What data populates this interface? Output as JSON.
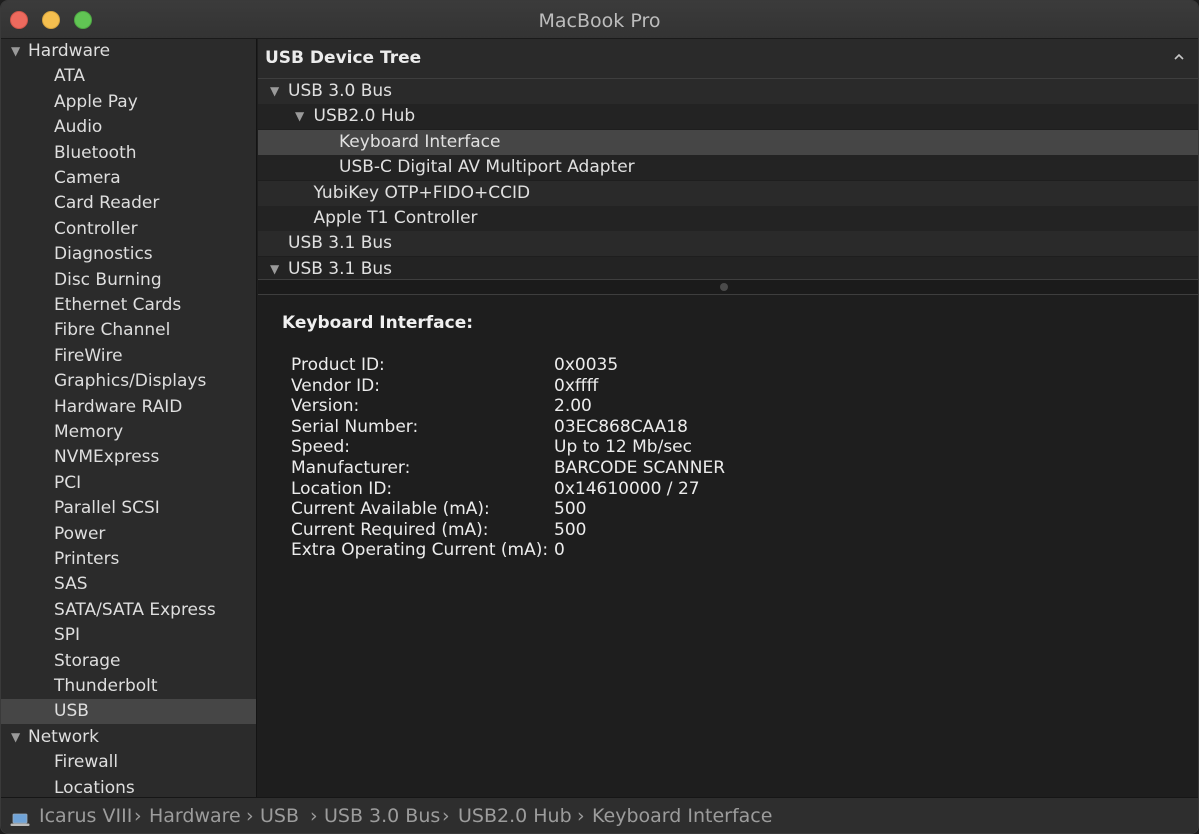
{
  "window": {
    "title": "MacBook Pro"
  },
  "sidebar": {
    "groups": [
      {
        "label": "Hardware",
        "items": [
          "ATA",
          "Apple Pay",
          "Audio",
          "Bluetooth",
          "Camera",
          "Card Reader",
          "Controller",
          "Diagnostics",
          "Disc Burning",
          "Ethernet Cards",
          "Fibre Channel",
          "FireWire",
          "Graphics/Displays",
          "Hardware RAID",
          "Memory",
          "NVMExpress",
          "PCI",
          "Parallel SCSI",
          "Power",
          "Printers",
          "SAS",
          "SATA/SATA Express",
          "SPI",
          "Storage",
          "Thunderbolt",
          "USB"
        ]
      },
      {
        "label": "Network",
        "items": [
          "Firewall",
          "Locations"
        ]
      }
    ],
    "selected": "USB"
  },
  "tree": {
    "header": "USB Device Tree",
    "collapse_icon": "chevron-up-icon",
    "rows": [
      {
        "label": "USB 3.0 Bus",
        "expanded": true
      },
      {
        "label": "USB2.0 Hub",
        "expanded": true
      },
      {
        "label": "Keyboard Interface",
        "selected": true
      },
      {
        "label": "USB-C Digital AV Multiport Adapter"
      },
      {
        "label": "YubiKey OTP+FIDO+CCID"
      },
      {
        "label": "Apple T1 Controller"
      },
      {
        "label": "USB 3.1 Bus"
      },
      {
        "label": "USB 3.1 Bus",
        "expanded": true
      }
    ]
  },
  "detail": {
    "title": "Keyboard Interface:",
    "fields": [
      {
        "label": "Product ID:",
        "value": "0x0035"
      },
      {
        "label": "Vendor ID:",
        "value": "0xffff"
      },
      {
        "label": "Version:",
        "value": "2.00"
      },
      {
        "label": "Serial Number:",
        "value": "03EC868CAA18"
      },
      {
        "label": "Speed:",
        "value": "Up to 12 Mb/sec"
      },
      {
        "label": "Manufacturer:",
        "value": "BARCODE SCANNER"
      },
      {
        "label": "Location ID:",
        "value": "0x14610000 / 27"
      },
      {
        "label": "Current Available (mA):",
        "value": "500"
      },
      {
        "label": "Current Required (mA):",
        "value": "500"
      },
      {
        "label": "Extra Operating Current (mA):",
        "value": "0"
      }
    ]
  },
  "breadcrumb": {
    "icon": "laptop-icon",
    "separator": "›",
    "items": [
      "Icarus VIII",
      "Hardware",
      "USB",
      "USB 3.0 Bus",
      "USB2.0 Hub",
      "Keyboard Interface"
    ]
  },
  "colors": {
    "selection": "#464646",
    "background": "#1e1e1e",
    "sidebar": "#2b2b2b"
  }
}
